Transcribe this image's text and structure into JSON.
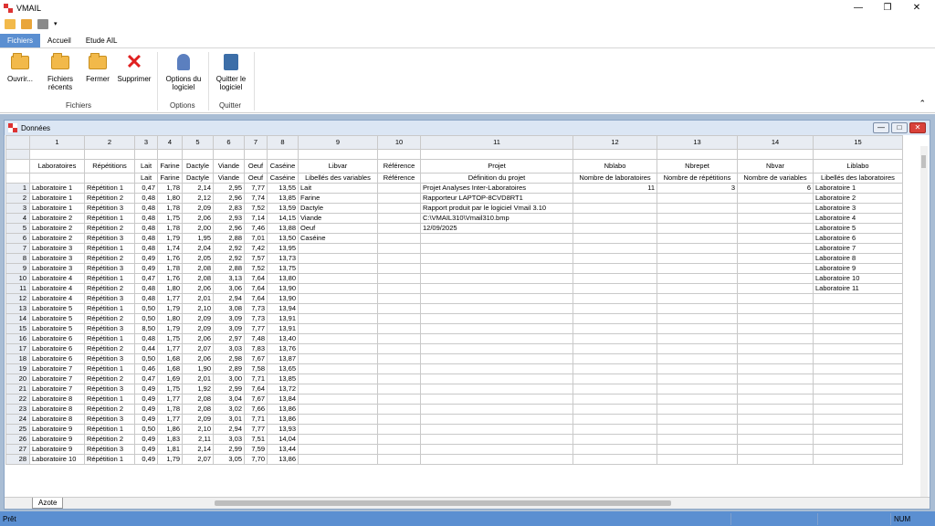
{
  "app": {
    "title": "VMAIL"
  },
  "tabs": [
    "Fichiers",
    "Accueil",
    "Etude AIL"
  ],
  "ribbon": {
    "open": "Ouvrir...",
    "recent": "Fichiers",
    "recent2": "récents",
    "close": "Fermer",
    "delete": "Supprimer",
    "options": "Options du",
    "options2": "logiciel",
    "quit": "Quitter le",
    "quit2": "logiciel",
    "group_files": "Fichiers",
    "group_options": "Options",
    "group_quit": "Quitter"
  },
  "window": {
    "title": "Données"
  },
  "columns": [
    "1",
    "2",
    "3",
    "4",
    "5",
    "6",
    "7",
    "8",
    "9",
    "10",
    "11",
    "12",
    "13",
    "14",
    "15"
  ],
  "label_row1": [
    "Laboratoires",
    "Répétitions",
    "Lait",
    "Farine",
    "Dactyle",
    "Viande",
    "Oeuf",
    "Caséine",
    "Libvar",
    "Référence",
    "Projet",
    "Nblabo",
    "Nbrepet",
    "Nbvar",
    "Liblabo"
  ],
  "label_row2": [
    "",
    "",
    "Lait",
    "Farine",
    "Dactyle",
    "Viande",
    "Oeuf",
    "Caséine",
    "Libellés des variables",
    "Référence",
    "Définition du projet",
    "Nombre de laboratoires",
    "Nombre de répétitions",
    "Nombre de variables",
    "Libellés des laboratoires"
  ],
  "rows": [
    [
      "1",
      "Laboratoire 1",
      "Répétition 1",
      "0,47",
      "1,78",
      "2,14",
      "2,95",
      "7,77",
      "13,55",
      "Lait",
      "",
      "Projet Analyses Inter-Laboratoires",
      "11",
      "3",
      "6",
      "Laboratoire 1"
    ],
    [
      "2",
      "Laboratoire 1",
      "Répétition 2",
      "0,48",
      "1,80",
      "2,12",
      "2,96",
      "7,74",
      "13,85",
      "Farine",
      "",
      "Rapporteur LAPTOP-8CVD8RT1",
      "",
      "",
      "",
      "Laboratoire 2"
    ],
    [
      "3",
      "Laboratoire 1",
      "Répétition 3",
      "0,48",
      "1,78",
      "2,09",
      "2,83",
      "7,52",
      "13,59",
      "Dactyle",
      "",
      "Rapport produit par le logiciel Vmail 3.10",
      "",
      "",
      "",
      "Laboratoire 3"
    ],
    [
      "4",
      "Laboratoire 2",
      "Répétition 1",
      "0,48",
      "1,75",
      "2,06",
      "2,93",
      "7,14",
      "14,15",
      "Viande",
      "",
      "C:\\VMAIL310\\Vmail310.bmp",
      "",
      "",
      "",
      "Laboratoire 4"
    ],
    [
      "5",
      "Laboratoire 2",
      "Répétition 2",
      "0,48",
      "1,78",
      "2,00",
      "2,96",
      "7,46",
      "13,88",
      "Oeuf",
      "",
      "12/09/2025",
      "",
      "",
      "",
      "Laboratoire 5"
    ],
    [
      "6",
      "Laboratoire 2",
      "Répétition 3",
      "0,48",
      "1,79",
      "1,95",
      "2,88",
      "7,01",
      "13,50",
      "Caséine",
      "",
      "",
      "",
      "",
      "",
      "Laboratoire 6"
    ],
    [
      "7",
      "Laboratoire 3",
      "Répétition 1",
      "0,48",
      "1,74",
      "2,04",
      "2,92",
      "7,42",
      "13,95",
      "",
      "",
      "",
      "",
      "",
      "",
      "Laboratoire 7"
    ],
    [
      "8",
      "Laboratoire 3",
      "Répétition 2",
      "0,49",
      "1,76",
      "2,05",
      "2,92",
      "7,57",
      "13,73",
      "",
      "",
      "",
      "",
      "",
      "",
      "Laboratoire 8"
    ],
    [
      "9",
      "Laboratoire 3",
      "Répétition 3",
      "0,49",
      "1,78",
      "2,08",
      "2,88",
      "7,52",
      "13,75",
      "",
      "",
      "",
      "",
      "",
      "",
      "Laboratoire 9"
    ],
    [
      "10",
      "Laboratoire 4",
      "Répétition 1",
      "0,47",
      "1,76",
      "2,08",
      "3,13",
      "7,64",
      "13,80",
      "",
      "",
      "",
      "",
      "",
      "",
      "Laboratoire 10"
    ],
    [
      "11",
      "Laboratoire 4",
      "Répétition 2",
      "0,48",
      "1,80",
      "2,06",
      "3,06",
      "7,64",
      "13,90",
      "",
      "",
      "",
      "",
      "",
      "",
      "Laboratoire 11"
    ],
    [
      "12",
      "Laboratoire 4",
      "Répétition 3",
      "0,48",
      "1,77",
      "2,01",
      "2,94",
      "7,64",
      "13,90",
      "",
      "",
      "",
      "",
      "",
      "",
      ""
    ],
    [
      "13",
      "Laboratoire 5",
      "Répétition 1",
      "0,50",
      "1,79",
      "2,10",
      "3,08",
      "7,73",
      "13,94",
      "",
      "",
      "",
      "",
      "",
      "",
      ""
    ],
    [
      "14",
      "Laboratoire 5",
      "Répétition 2",
      "0,50",
      "1,80",
      "2,09",
      "3,09",
      "7,73",
      "13,91",
      "",
      "",
      "",
      "",
      "",
      "",
      ""
    ],
    [
      "15",
      "Laboratoire 5",
      "Répétition 3",
      "8,50",
      "1,79",
      "2,09",
      "3,09",
      "7,77",
      "13,91",
      "",
      "",
      "",
      "",
      "",
      "",
      ""
    ],
    [
      "16",
      "Laboratoire 6",
      "Répétition 1",
      "0,48",
      "1,75",
      "2,06",
      "2,97",
      "7,48",
      "13,40",
      "",
      "",
      "",
      "",
      "",
      "",
      ""
    ],
    [
      "17",
      "Laboratoire 6",
      "Répétition 2",
      "0,44",
      "1,77",
      "2,07",
      "3,03",
      "7,83",
      "13,76",
      "",
      "",
      "",
      "",
      "",
      "",
      ""
    ],
    [
      "18",
      "Laboratoire 6",
      "Répétition 3",
      "0,50",
      "1,68",
      "2,06",
      "2,98",
      "7,67",
      "13,87",
      "",
      "",
      "",
      "",
      "",
      "",
      ""
    ],
    [
      "19",
      "Laboratoire 7",
      "Répétition 1",
      "0,46",
      "1,68",
      "1,90",
      "2,89",
      "7,58",
      "13,65",
      "",
      "",
      "",
      "",
      "",
      "",
      ""
    ],
    [
      "20",
      "Laboratoire 7",
      "Répétition 2",
      "0,47",
      "1,69",
      "2,01",
      "3,00",
      "7,71",
      "13,85",
      "",
      "",
      "",
      "",
      "",
      "",
      ""
    ],
    [
      "21",
      "Laboratoire 7",
      "Répétition 3",
      "0,49",
      "1,75",
      "1,92",
      "2,99",
      "7,64",
      "13,72",
      "",
      "",
      "",
      "",
      "",
      "",
      ""
    ],
    [
      "22",
      "Laboratoire 8",
      "Répétition 1",
      "0,49",
      "1,77",
      "2,08",
      "3,04",
      "7,67",
      "13,84",
      "",
      "",
      "",
      "",
      "",
      "",
      ""
    ],
    [
      "23",
      "Laboratoire 8",
      "Répétition 2",
      "0,49",
      "1,78",
      "2,08",
      "3,02",
      "7,66",
      "13,86",
      "",
      "",
      "",
      "",
      "",
      "",
      ""
    ],
    [
      "24",
      "Laboratoire 8",
      "Répétition 3",
      "0,49",
      "1,77",
      "2,09",
      "3,01",
      "7,71",
      "13,86",
      "",
      "",
      "",
      "",
      "",
      "",
      ""
    ],
    [
      "25",
      "Laboratoire 9",
      "Répétition 1",
      "0,50",
      "1,86",
      "2,10",
      "2,94",
      "7,77",
      "13,93",
      "",
      "",
      "",
      "",
      "",
      "",
      ""
    ],
    [
      "26",
      "Laboratoire 9",
      "Répétition 2",
      "0,49",
      "1,83",
      "2,11",
      "3,03",
      "7,51",
      "14,04",
      "",
      "",
      "",
      "",
      "",
      "",
      ""
    ],
    [
      "27",
      "Laboratoire 9",
      "Répétition 3",
      "0,49",
      "1,81",
      "2,14",
      "2,99",
      "7,59",
      "13,44",
      "",
      "",
      "",
      "",
      "",
      "",
      ""
    ],
    [
      "28",
      "Laboratoire 10",
      "Répétition 1",
      "0,49",
      "1,79",
      "2,07",
      "3,05",
      "7,70",
      "13,86",
      "",
      "",
      "",
      "",
      "",
      "",
      ""
    ]
  ],
  "sheet_tab": "Azote",
  "status": {
    "left": "Prêt",
    "num": "NUM"
  },
  "colors": {
    "accent": "#5b8fd1"
  }
}
